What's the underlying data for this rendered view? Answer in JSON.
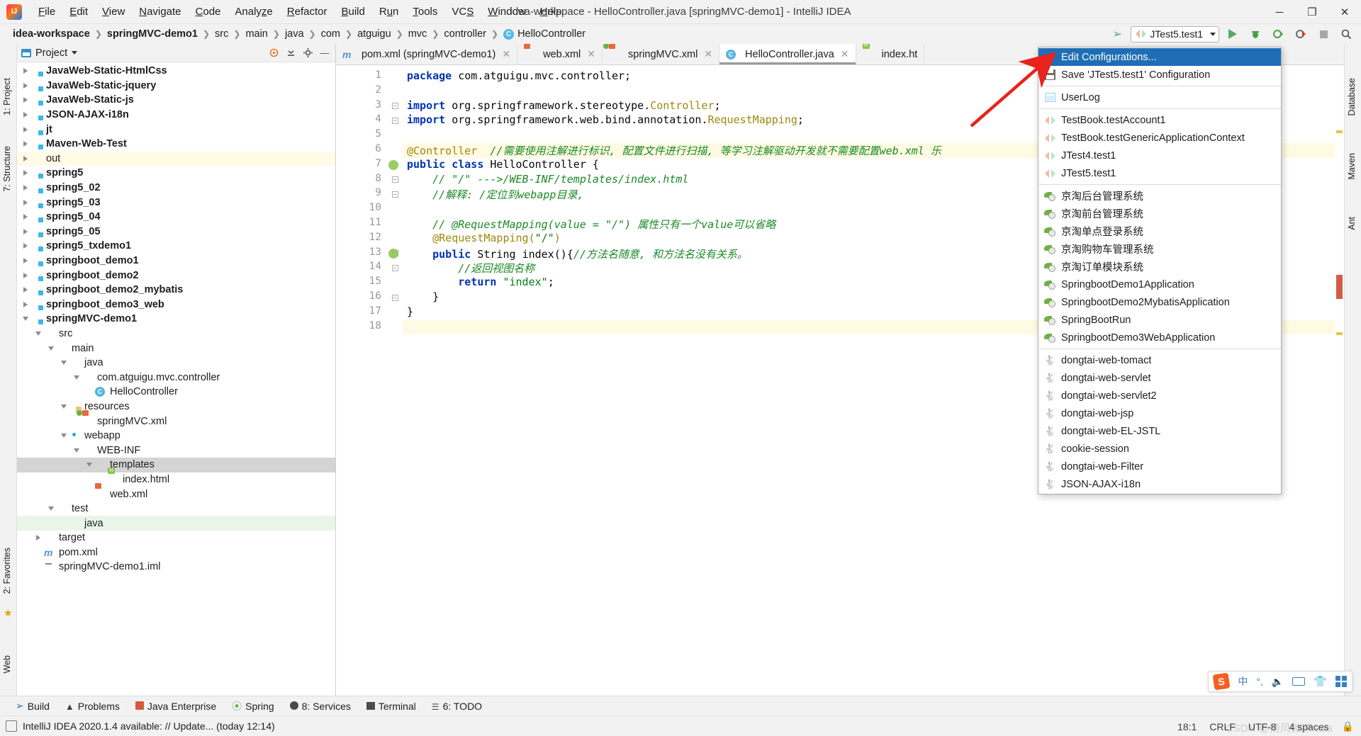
{
  "window": {
    "title": "idea-workspace - HelloController.java [springMVC-demo1] - IntelliJ IDEA",
    "logo_text": "IJ",
    "minimize": "─",
    "maximize": "❐",
    "close": "✕"
  },
  "menubar": [
    {
      "label": "File"
    },
    {
      "label": "Edit"
    },
    {
      "label": "View"
    },
    {
      "label": "Navigate"
    },
    {
      "label": "Code"
    },
    {
      "label": "Analyze"
    },
    {
      "label": "Refactor"
    },
    {
      "label": "Build"
    },
    {
      "label": "Run"
    },
    {
      "label": "Tools"
    },
    {
      "label": "VCS"
    },
    {
      "label": "Window"
    },
    {
      "label": "Help"
    }
  ],
  "breadcrumb": [
    {
      "label": "idea-workspace",
      "bold": true
    },
    {
      "label": "springMVC-demo1",
      "bold": true
    },
    {
      "label": "src",
      "bold": false
    },
    {
      "label": "main",
      "bold": false
    },
    {
      "label": "java",
      "bold": false
    },
    {
      "label": "com",
      "bold": false
    },
    {
      "label": "atguigu",
      "bold": false
    },
    {
      "label": "mvc",
      "bold": false
    },
    {
      "label": "controller",
      "bold": false
    },
    {
      "label": "HelloController",
      "bold": false,
      "icon": "class-icon",
      "icon_letter": "C"
    }
  ],
  "run_widget": {
    "selected": "JTest5.test1",
    "run_tooltip": "Run",
    "debug_tooltip": "Debug",
    "coverage_tooltip": "Run with Coverage",
    "profile_tooltip": "Profile",
    "stop_tooltip": "Stop"
  },
  "project_panel": {
    "title": "Project",
    "tree": [
      {
        "label": "JavaWeb-Static-HtmlCss",
        "indent": 1,
        "twisty": "right",
        "icon": "module-folder-icon",
        "bold": true
      },
      {
        "label": "JavaWeb-Static-jquery",
        "indent": 1,
        "twisty": "right",
        "icon": "module-folder-icon",
        "bold": true
      },
      {
        "label": "JavaWeb-Static-js",
        "indent": 1,
        "twisty": "right",
        "icon": "module-folder-icon",
        "bold": true
      },
      {
        "label": "JSON-AJAX-i18n",
        "indent": 1,
        "twisty": "right",
        "icon": "module-folder-icon",
        "bold": true
      },
      {
        "label": "jt",
        "indent": 1,
        "twisty": "right",
        "icon": "module-folder-icon",
        "bold": true
      },
      {
        "label": "Maven-Web-Test",
        "indent": 1,
        "twisty": "right",
        "icon": "module-folder-icon",
        "bold": true
      },
      {
        "label": "out",
        "indent": 1,
        "twisty": "right",
        "icon": "folder-orange-icon",
        "bold": false,
        "highlight": "yellow"
      },
      {
        "label": "spring5",
        "indent": 1,
        "twisty": "right",
        "icon": "module-folder-icon",
        "bold": true
      },
      {
        "label": "spring5_02",
        "indent": 1,
        "twisty": "right",
        "icon": "module-folder-icon",
        "bold": true
      },
      {
        "label": "spring5_03",
        "indent": 1,
        "twisty": "right",
        "icon": "module-folder-icon",
        "bold": true
      },
      {
        "label": "spring5_04",
        "indent": 1,
        "twisty": "right",
        "icon": "module-folder-icon",
        "bold": true
      },
      {
        "label": "spring5_05",
        "indent": 1,
        "twisty": "right",
        "icon": "module-folder-icon",
        "bold": true
      },
      {
        "label": "spring5_txdemo1",
        "indent": 1,
        "twisty": "right",
        "icon": "module-folder-icon",
        "bold": true
      },
      {
        "label": "springboot_demo1",
        "indent": 1,
        "twisty": "right",
        "icon": "module-folder-icon",
        "bold": true
      },
      {
        "label": "springboot_demo2",
        "indent": 1,
        "twisty": "right",
        "icon": "module-folder-icon",
        "bold": true
      },
      {
        "label": "springboot_demo2_mybatis",
        "indent": 1,
        "twisty": "right",
        "icon": "module-folder-icon",
        "bold": true
      },
      {
        "label": "springboot_demo3_web",
        "indent": 1,
        "twisty": "right",
        "icon": "module-folder-icon",
        "bold": true
      },
      {
        "label": "springMVC-demo1",
        "indent": 1,
        "twisty": "down",
        "icon": "module-folder-icon",
        "bold": true
      },
      {
        "label": "src",
        "indent": 2,
        "twisty": "down",
        "icon": "folder-icon",
        "bold": false
      },
      {
        "label": "main",
        "indent": 3,
        "twisty": "down",
        "icon": "folder-icon",
        "bold": false
      },
      {
        "label": "java",
        "indent": 4,
        "twisty": "down",
        "icon": "folder-blue-icon",
        "bold": false
      },
      {
        "label": "com.atguigu.mvc.controller",
        "indent": 5,
        "twisty": "down",
        "icon": "package-icon",
        "bold": false
      },
      {
        "label": "HelloController",
        "indent": 6,
        "twisty": "none",
        "icon": "class-icon",
        "bold": false
      },
      {
        "label": "resources",
        "indent": 4,
        "twisty": "down",
        "icon": "resources-folder-icon",
        "bold": false
      },
      {
        "label": "springMVC.xml",
        "indent": 5,
        "twisty": "none",
        "icon": "spring-xml-icon",
        "bold": false
      },
      {
        "label": "webapp",
        "indent": 4,
        "twisty": "down",
        "icon": "webapp-folder-icon",
        "bold": false
      },
      {
        "label": "WEB-INF",
        "indent": 5,
        "twisty": "down",
        "icon": "folder-icon",
        "bold": false
      },
      {
        "label": "templates",
        "indent": 6,
        "twisty": "down",
        "icon": "folder-icon",
        "bold": false,
        "highlight": "gray"
      },
      {
        "label": "index.html",
        "indent": 7,
        "twisty": "none",
        "icon": "html-icon",
        "bold": false
      },
      {
        "label": "web.xml",
        "indent": 6,
        "twisty": "none",
        "icon": "xml-icon",
        "bold": false
      },
      {
        "label": "test",
        "indent": 3,
        "twisty": "down",
        "icon": "folder-icon",
        "bold": false
      },
      {
        "label": "java",
        "indent": 4,
        "twisty": "none",
        "icon": "folder-blue-icon",
        "bold": false,
        "highlight": "green"
      },
      {
        "label": "target",
        "indent": 2,
        "twisty": "right",
        "icon": "folder-orange-icon",
        "bold": false
      },
      {
        "label": "pom.xml",
        "indent": 2,
        "twisty": "none",
        "icon": "maven-icon",
        "bold": false
      },
      {
        "label": "springMVC-demo1.iml",
        "indent": 2,
        "twisty": "none",
        "icon": "iml-icon",
        "bold": false
      }
    ]
  },
  "editor": {
    "tabs": [
      {
        "label": "pom.xml (springMVC-demo1)",
        "icon": "maven-icon",
        "active": false,
        "closable": true
      },
      {
        "label": "web.xml",
        "icon": "xml-icon",
        "active": false,
        "closable": true
      },
      {
        "label": "springMVC.xml",
        "icon": "spring-xml-icon",
        "active": false,
        "closable": true
      },
      {
        "label": "HelloController.java",
        "icon": "class-icon",
        "active": true,
        "closable": true
      },
      {
        "label": "index.ht",
        "icon": "html-icon",
        "active": false,
        "closable": false
      }
    ],
    "lines": [
      {
        "n": 1,
        "marker": false,
        "fold": "none",
        "highlight": false,
        "tokens": [
          {
            "t": "package ",
            "c": "kw"
          },
          {
            "t": "com.atguigu.mvc.controller;",
            "c": "pln"
          }
        ]
      },
      {
        "n": 2,
        "marker": false,
        "fold": "none",
        "highlight": false,
        "tokens": []
      },
      {
        "n": 3,
        "marker": false,
        "fold": "minus",
        "highlight": false,
        "tokens": [
          {
            "t": "import ",
            "c": "kw"
          },
          {
            "t": "org.springframework.stereotype.",
            "c": "pln"
          },
          {
            "t": "Controller",
            "c": "typ"
          },
          {
            "t": ";",
            "c": "pln"
          }
        ]
      },
      {
        "n": 4,
        "marker": false,
        "fold": "plus",
        "highlight": false,
        "tokens": [
          {
            "t": "import ",
            "c": "kw"
          },
          {
            "t": "org.springframework.web.bind.annotation.",
            "c": "pln"
          },
          {
            "t": "RequestMapping",
            "c": "typ"
          },
          {
            "t": ";",
            "c": "pln"
          }
        ]
      },
      {
        "n": 5,
        "marker": false,
        "fold": "none",
        "highlight": false,
        "tokens": []
      },
      {
        "n": 6,
        "marker": false,
        "fold": "none",
        "highlight": true,
        "tokens": [
          {
            "t": "@Controller",
            "c": "ann"
          },
          {
            "t": "  ",
            "c": "pln"
          },
          {
            "t": "//需要使用注解进行标识, 配置文件进行扫描, 等学习注解驱动开发就不需要配置web.xml 乐",
            "c": "cmt"
          }
        ]
      },
      {
        "n": 7,
        "marker": true,
        "fold": "none",
        "highlight": false,
        "tokens": [
          {
            "t": "public ",
            "c": "kw"
          },
          {
            "t": "class ",
            "c": "kw"
          },
          {
            "t": "HelloController {",
            "c": "pln"
          }
        ]
      },
      {
        "n": 8,
        "marker": false,
        "fold": "minus",
        "highlight": false,
        "tokens": [
          {
            "t": "    // \"/\" --->/WEB-INF/templates/index.html",
            "c": "cmt"
          }
        ]
      },
      {
        "n": 9,
        "marker": false,
        "fold": "plus",
        "highlight": false,
        "tokens": [
          {
            "t": "    //解释: /定位到webapp目录,",
            "c": "cmt"
          }
        ]
      },
      {
        "n": 10,
        "marker": false,
        "fold": "none",
        "highlight": false,
        "tokens": []
      },
      {
        "n": 11,
        "marker": false,
        "fold": "none",
        "highlight": false,
        "tokens": [
          {
            "t": "    // @RequestMapping(value = \"/\") 属性只有一个value可以省略",
            "c": "cmt"
          }
        ]
      },
      {
        "n": 12,
        "marker": false,
        "fold": "none",
        "highlight": false,
        "tokens": [
          {
            "t": "    @RequestMapping(",
            "c": "ann"
          },
          {
            "t": "\"/\"",
            "c": "str"
          },
          {
            "t": ")",
            "c": "ann"
          }
        ]
      },
      {
        "n": 13,
        "marker": true,
        "fold": "minus",
        "highlight": false,
        "tokens": [
          {
            "t": "    public ",
            "c": "kw"
          },
          {
            "t": "String ",
            "c": "pln"
          },
          {
            "t": "index",
            "c": "pln"
          },
          {
            "t": "(){",
            "c": "pln"
          },
          {
            "t": "//方法名随意, 和方法名没有关系。",
            "c": "cmt"
          }
        ]
      },
      {
        "n": 14,
        "marker": false,
        "fold": "plus",
        "highlight": false,
        "tokens": [
          {
            "t": "        //返回视图名称",
            "c": "cmt"
          }
        ]
      },
      {
        "n": 15,
        "marker": false,
        "fold": "none",
        "highlight": false,
        "tokens": [
          {
            "t": "        return ",
            "c": "kw"
          },
          {
            "t": "\"index\"",
            "c": "str"
          },
          {
            "t": ";",
            "c": "pln"
          }
        ]
      },
      {
        "n": 16,
        "marker": false,
        "fold": "plus",
        "highlight": false,
        "tokens": [
          {
            "t": "    }",
            "c": "pln"
          }
        ]
      },
      {
        "n": 17,
        "marker": false,
        "fold": "none",
        "highlight": false,
        "tokens": [
          {
            "t": "}",
            "c": "pln"
          }
        ]
      },
      {
        "n": 18,
        "marker": false,
        "fold": "none",
        "highlight": true,
        "tokens": []
      }
    ]
  },
  "run_dropdown": {
    "groups": [
      {
        "items": [
          {
            "label": "Edit Configurations...",
            "icon": "none",
            "highlighted": true
          },
          {
            "label": "Save 'JTest5.test1' Configuration",
            "icon": "save-icon",
            "highlighted": false
          }
        ]
      },
      {
        "items": [
          {
            "label": "UserLog",
            "icon": "userlog-icon",
            "highlighted": false
          }
        ]
      },
      {
        "items": [
          {
            "label": "TestBook.testAccount1",
            "icon": "junit-icon",
            "highlighted": false
          },
          {
            "label": "TestBook.testGenericApplicationContext",
            "icon": "junit-icon",
            "highlighted": false
          },
          {
            "label": "JTest4.test1",
            "icon": "junit-icon",
            "highlighted": false
          },
          {
            "label": "JTest5.test1",
            "icon": "junit-icon",
            "highlighted": false
          }
        ]
      },
      {
        "items": [
          {
            "label": "京淘后台管理系统",
            "icon": "spring-boot-icon",
            "highlighted": false
          },
          {
            "label": "京淘前台管理系统",
            "icon": "spring-boot-icon",
            "highlighted": false
          },
          {
            "label": "京淘单点登录系统",
            "icon": "spring-boot-icon",
            "highlighted": false
          },
          {
            "label": "京淘购物车管理系统",
            "icon": "spring-boot-icon",
            "highlighted": false
          },
          {
            "label": "京淘订单模块系统",
            "icon": "spring-boot-icon",
            "highlighted": false
          },
          {
            "label": "SpringbootDemo1Application",
            "icon": "spring-boot-icon",
            "highlighted": false
          },
          {
            "label": "SpringbootDemo2MybatisApplication",
            "icon": "spring-boot-icon",
            "highlighted": false
          },
          {
            "label": "SpringBootRun",
            "icon": "spring-boot-icon",
            "highlighted": false
          },
          {
            "label": "SpringbootDemo3WebApplication",
            "icon": "spring-boot-icon",
            "highlighted": false
          }
        ]
      },
      {
        "items": [
          {
            "label": "dongtai-web-tomact",
            "icon": "tomcat-icon",
            "highlighted": false
          },
          {
            "label": "dongtai-web-servlet",
            "icon": "tomcat-icon",
            "highlighted": false
          },
          {
            "label": "dongtai-web-servlet2",
            "icon": "tomcat-icon",
            "highlighted": false
          },
          {
            "label": "dongtai-web-jsp",
            "icon": "tomcat-icon",
            "highlighted": false
          },
          {
            "label": "dongtai-web-EL-JSTL",
            "icon": "tomcat-icon",
            "highlighted": false
          },
          {
            "label": "cookie-session",
            "icon": "tomcat-icon",
            "highlighted": false
          },
          {
            "label": "dongtai-web-Filter",
            "icon": "tomcat-icon",
            "highlighted": false
          },
          {
            "label": "JSON-AJAX-i18n",
            "icon": "tomcat-icon",
            "highlighted": false
          }
        ]
      }
    ]
  },
  "left_rail": [
    {
      "label": "1: Project"
    },
    {
      "label": "7: Structure"
    },
    {
      "label": "2: Favorites"
    },
    {
      "label": "Web"
    }
  ],
  "right_rail": [
    {
      "label": "Database"
    },
    {
      "label": "Maven"
    },
    {
      "label": "Ant"
    }
  ],
  "bottom_tool_windows": [
    {
      "label": "Build",
      "icon": "hammer-icon"
    },
    {
      "label": "Problems",
      "icon": "warning-icon"
    },
    {
      "label": "Java Enterprise",
      "icon": "jee-icon"
    },
    {
      "label": "Spring",
      "icon": "spring-leaf-icon"
    },
    {
      "label": "8: Services",
      "icon": "services-icon"
    },
    {
      "label": "Terminal",
      "icon": "terminal-icon"
    },
    {
      "label": "6: TODO",
      "icon": "todo-icon"
    }
  ],
  "status_bar": {
    "message": "IntelliJ IDEA 2020.1.4 available: // Update... (today 12:14)",
    "caret": "18:1",
    "line_separator": "CRLF",
    "encoding": "UTF-8",
    "indent": "4 spaces",
    "watermark": "CSDN @情风微凉.aaa"
  },
  "ime_bar": {
    "logo": "S",
    "mode": "中",
    "punctuation": "°,",
    "voice": "voice-icon",
    "keyboard": "keyboard-icon",
    "skin": "skin-icon",
    "toolbox": "toolbox-icon"
  },
  "colors": {
    "accent_blue": "#1f6eb5",
    "spring_green": "#6db33f",
    "keyword": "#0033b3",
    "comment": "#1a8a24",
    "string": "#067d17",
    "annotation": "#9e880d",
    "arrow_red": "#e8221c"
  }
}
